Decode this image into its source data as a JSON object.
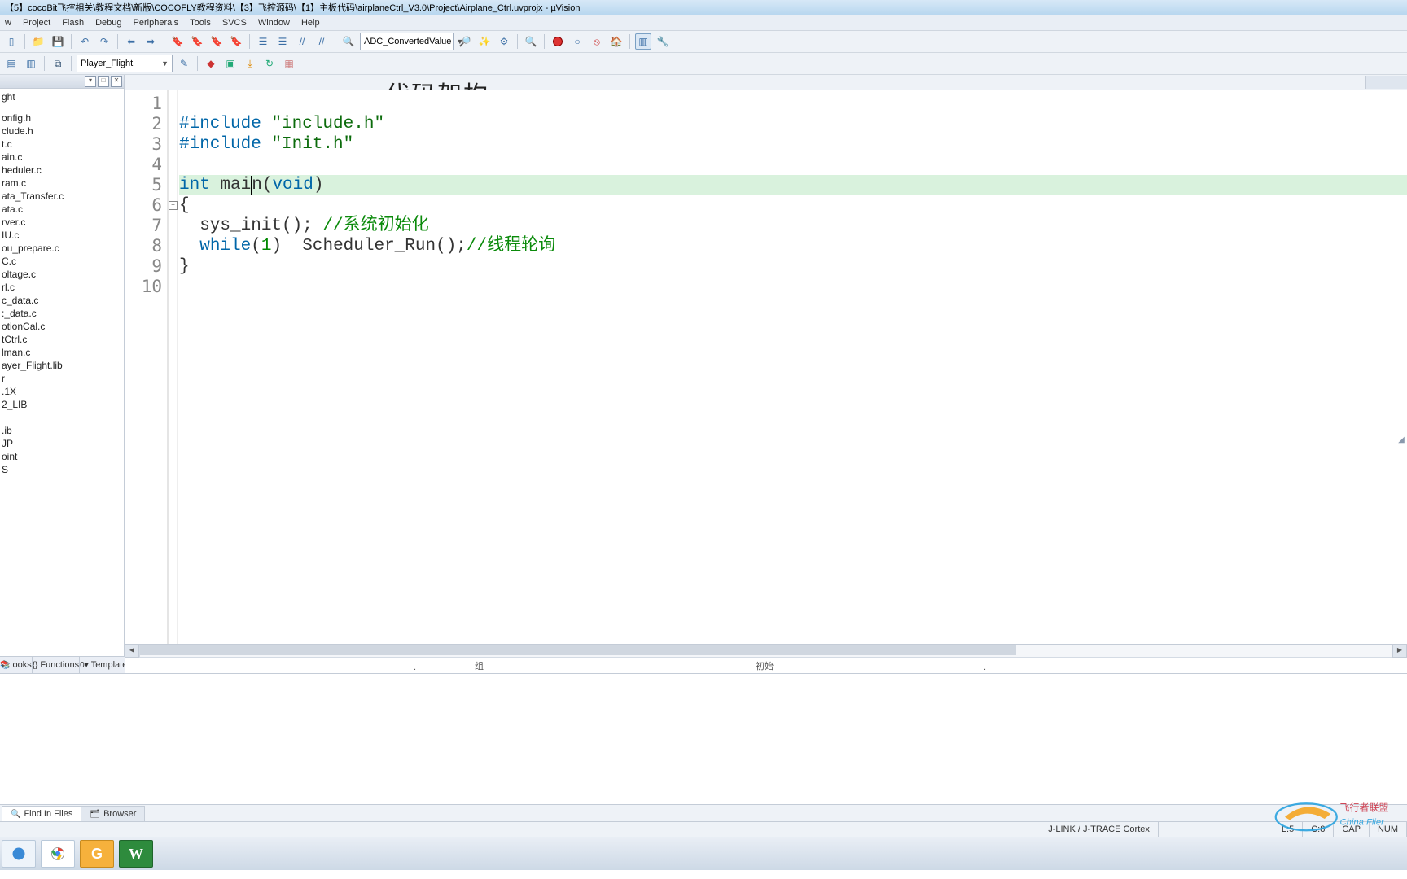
{
  "window": {
    "title": "【5】cocoBit飞控相关\\教程文档\\新版\\COCOFLY教程资料\\【3】飞控源码\\【1】主板代码\\airplaneCtrl_V3.0\\Project\\Airplane_Ctrl.uvprojx - µVision"
  },
  "menu": {
    "items": [
      "w",
      "Project",
      "Flash",
      "Debug",
      "Peripherals",
      "Tools",
      "SVCS",
      "Window",
      "Help"
    ]
  },
  "toolbar1": {
    "combo_value": "ADC_ConvertedValue"
  },
  "toolbar2": {
    "combo_value": "Player_Flight"
  },
  "sidebar": {
    "header_icons": [
      "▾",
      "□",
      "✕"
    ],
    "items": [
      "ght",
      "onfig.h",
      "clude.h",
      "t.c",
      "ain.c",
      "heduler.c",
      "ram.c",
      "ata_Transfer.c",
      "ata.c",
      "rver.c",
      "IU.c",
      "ou_prepare.c",
      "C.c",
      "oltage.c",
      "rl.c",
      "c_data.c",
      ":_data.c",
      "otionCal.c",
      "tCtrl.c",
      "lman.c",
      "ayer_Flight.lib",
      "r",
      ".1X",
      "2_LIB",
      "",
      ".ib",
      "JP",
      "oint",
      "S"
    ],
    "tabs": [
      {
        "icon": "📚",
        "label": "ooks"
      },
      {
        "icon": "{}",
        "label": "Functions"
      },
      {
        "icon": "0▾",
        "label": "Templates"
      }
    ]
  },
  "editor": {
    "overlay_title": "代码架构",
    "line_count": 10,
    "fold_marker_line": 6,
    "fold_symbol": "−",
    "highlight_line": 5,
    "lines": [
      {
        "n": 1,
        "tokens": [
          {
            "t": "",
            "c": ""
          }
        ]
      },
      {
        "n": 2,
        "tokens": [
          {
            "t": "#include ",
            "c": "kw"
          },
          {
            "t": "\"include.h\"",
            "c": "str"
          }
        ]
      },
      {
        "n": 3,
        "tokens": [
          {
            "t": "#include ",
            "c": "kw"
          },
          {
            "t": "\"Init.h\"",
            "c": "str"
          }
        ]
      },
      {
        "n": 4,
        "tokens": [
          {
            "t": "",
            "c": ""
          }
        ]
      },
      {
        "n": 5,
        "tokens": [
          {
            "t": "int",
            "c": "ty"
          },
          {
            "t": " mai",
            "c": ""
          },
          {
            "t": "",
            "c": "caret"
          },
          {
            "t": "n",
            "c": ""
          },
          {
            "t": "(",
            "c": ""
          },
          {
            "t": "void",
            "c": "ty"
          },
          {
            "t": ")",
            "c": ""
          }
        ]
      },
      {
        "n": 6,
        "tokens": [
          {
            "t": "{",
            "c": ""
          }
        ]
      },
      {
        "n": 7,
        "tokens": [
          {
            "t": "  sys_init(); ",
            "c": ""
          },
          {
            "t": "//系统初始化",
            "c": "cmt"
          }
        ]
      },
      {
        "n": 8,
        "tokens": [
          {
            "t": "  ",
            "c": ""
          },
          {
            "t": "while",
            "c": "kw"
          },
          {
            "t": "(",
            "c": ""
          },
          {
            "t": "1",
            "c": "num"
          },
          {
            "t": ")  Scheduler_Run();",
            "c": ""
          },
          {
            "t": "//线程轮询",
            "c": "cmt"
          }
        ]
      },
      {
        "n": 9,
        "tokens": [
          {
            "t": "}",
            "c": ""
          }
        ]
      },
      {
        "n": 10,
        "tokens": [
          {
            "t": "",
            "c": ""
          }
        ]
      }
    ],
    "under_marks": [
      {
        "pos": 355,
        "text": "."
      },
      {
        "pos": 430,
        "text": "组"
      },
      {
        "pos": 775,
        "text": "初始"
      },
      {
        "pos": 1055,
        "text": "."
      }
    ]
  },
  "bottom_tabs": [
    {
      "icon": "🔍",
      "label": "Find In Files",
      "active": true
    },
    {
      "icon": "🗂",
      "label": "Browser",
      "active": false
    }
  ],
  "status": {
    "segments_right": [
      "J-LINK / J-TRACE Cortex",
      "",
      "L:5",
      "C:8",
      "CAP",
      "NUM"
    ]
  },
  "taskbar": {
    "items": [
      {
        "name": "start",
        "color": "#f3f6fa",
        "glyph": ""
      },
      {
        "name": "chrome",
        "color": "#fff",
        "glyph": "◎"
      },
      {
        "name": "foxit",
        "color": "#f6b13c",
        "glyph": "G"
      },
      {
        "name": "wps",
        "color": "#2e8b3d",
        "glyph": "W"
      }
    ]
  },
  "watermark": {
    "line1": "飞行者联盟",
    "line2": "China Flier"
  }
}
